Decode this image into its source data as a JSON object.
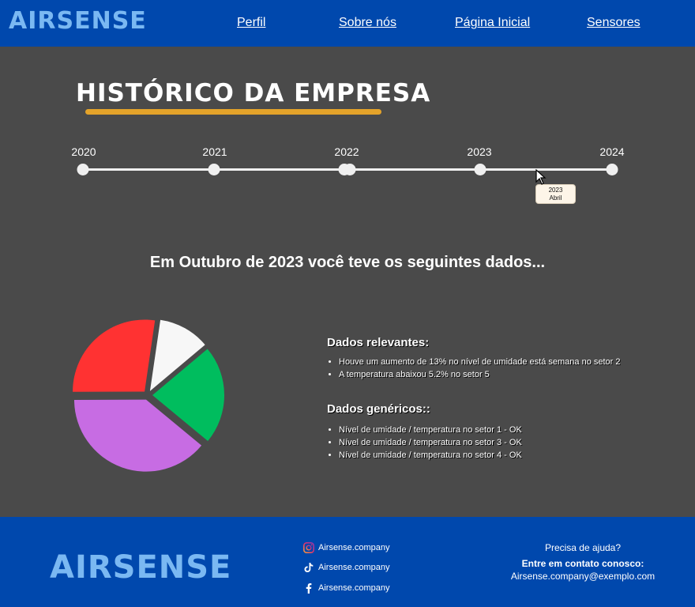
{
  "brand": "AIRSENSE",
  "nav": [
    "Perfil",
    "Sobre nós",
    "Página Inicial",
    "Sensores"
  ],
  "timeline": {
    "title": "HISTÓRICO DA EMPRESA",
    "years": [
      "2020",
      "2021",
      "2022",
      "2023",
      "2024"
    ],
    "tooltip": {
      "year": "2023",
      "month": "Abril"
    }
  },
  "subtitle": "Em Outubro de 2023 você teve os seguintes dados...",
  "chart_data": {
    "type": "pie",
    "slices": [
      {
        "value": 21,
        "color": "#00bd5e"
      },
      {
        "value": 37,
        "color": "#c76ce3"
      },
      {
        "value": 26,
        "color": "#ff3232"
      },
      {
        "value": 11,
        "color": "#f7f7f7"
      }
    ]
  },
  "relevant": {
    "heading": "Dados relevantes:",
    "items": [
      "Houve um aumento de 13% no nível de umidade está semana no setor 2",
      "A temperatura abaixou  5.2% no setor 5"
    ]
  },
  "generic": {
    "heading": "Dados genéricos::",
    "items": [
      "Nível de umidade / temperatura no setor 1 - OK",
      "Nível de umidade / temperatura no setor 3 - OK",
      "Nível de umidade / temperatura no setor 4 - OK"
    ]
  },
  "footer": {
    "social": [
      {
        "icon": "instagram-icon",
        "label": "Airsense.company"
      },
      {
        "icon": "tiktok-icon",
        "label": "Airsense.company"
      },
      {
        "icon": "facebook-icon",
        "label": "Airsense.company"
      }
    ],
    "help_question": "Precisa de ajuda?",
    "contact_label": "Entre em contato conosco:",
    "email": "Airsense.company@exemplo.com"
  },
  "colors": {
    "header_bg": "#0048ad",
    "page_bg": "#4a4a4a",
    "brand_text": "#7ab8f2",
    "accent": "#e4a32a"
  }
}
